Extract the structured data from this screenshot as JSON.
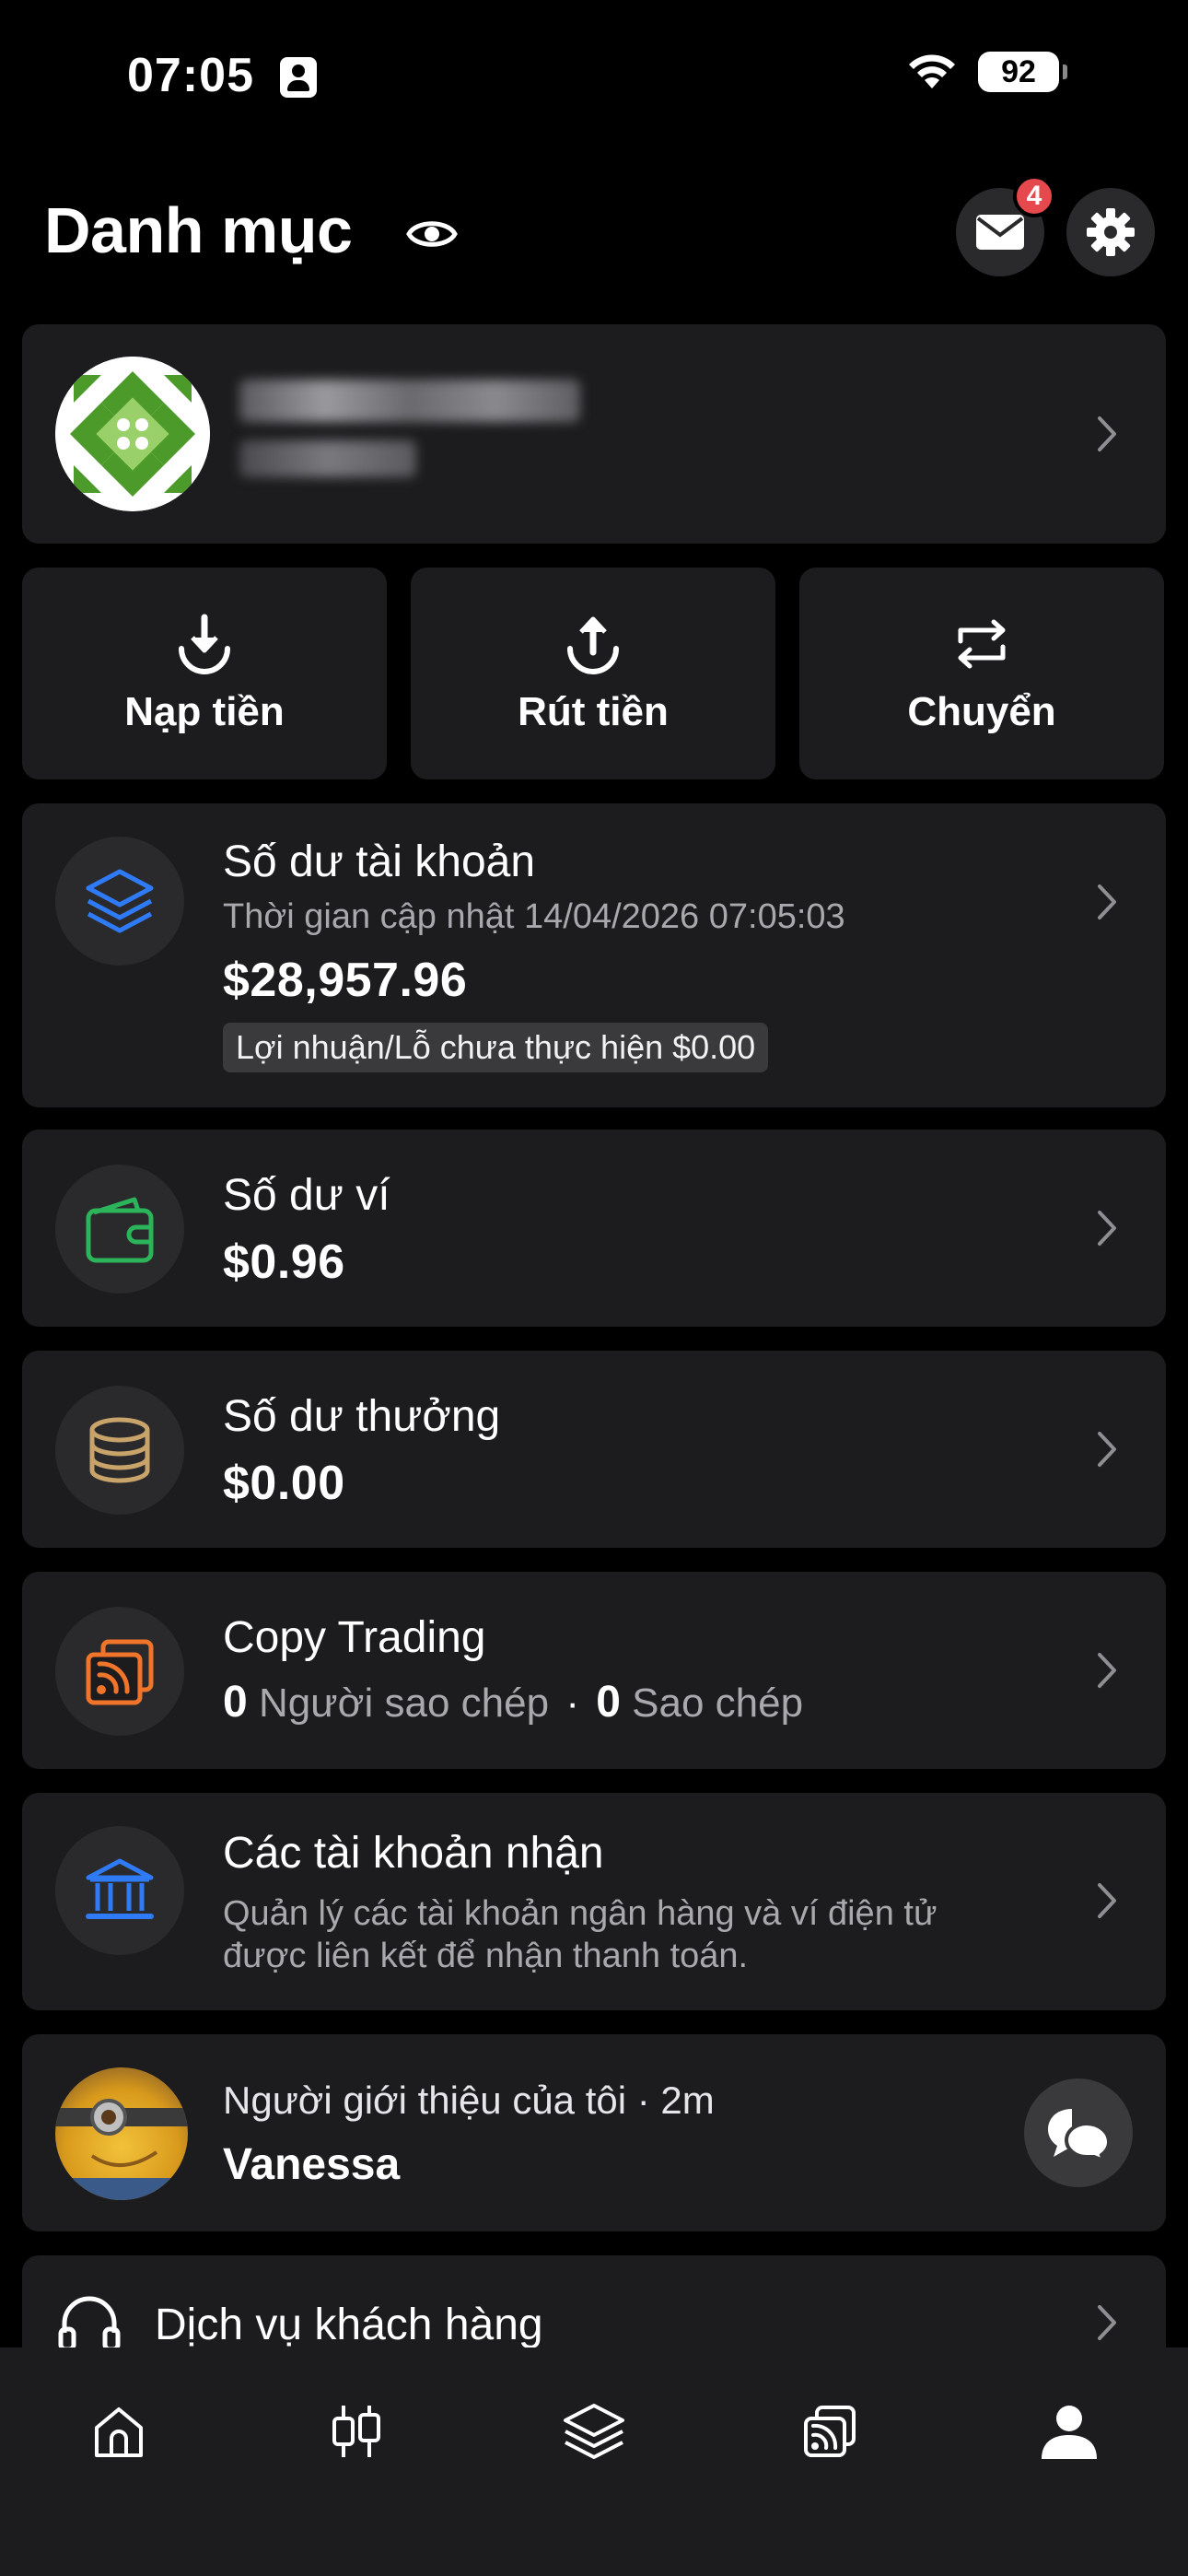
{
  "status": {
    "time": "07:05",
    "battery": "92"
  },
  "header": {
    "title": "Danh mục",
    "mail_badge": "4"
  },
  "actions": [
    {
      "label": "Nạp tiền",
      "icon": "download-icon"
    },
    {
      "label": "Rút tiền",
      "icon": "upload-icon"
    },
    {
      "label": "Chuyển",
      "icon": "transfer-icon"
    }
  ],
  "account_balance": {
    "title": "Số dư tài khoản",
    "updated": "Thời gian cập nhật 14/04/2026 07:05:03",
    "value": "$28,957.96",
    "unrealized": "Lợi nhuận/Lỗ chưa thực hiện $0.00"
  },
  "wallet": {
    "title": "Số dư ví",
    "value": "$0.96"
  },
  "bonus": {
    "title": "Số dư thưởng",
    "value": "$0.00"
  },
  "copy_trading": {
    "title": "Copy Trading",
    "followers_count": "0",
    "followers_label": "Người sao chép",
    "sep": "·",
    "copies_count": "0",
    "copies_label": "Sao chép"
  },
  "receiving_accounts": {
    "title": "Các tài khoản nhận",
    "desc_line1": "Quản lý các tài khoản ngân hàng và ví điện tử",
    "desc_line2": "được liên kết để nhận thanh toán."
  },
  "referrer": {
    "label": "Người giới thiệu của tôi · 2m",
    "name": "Vanessa"
  },
  "support": {
    "title": "Dịch vụ khách hàng"
  },
  "colors": {
    "card": "#1c1c1e",
    "blue": "#2f7bf5",
    "green": "#2bb45a",
    "gold": "#c9a46a",
    "orange": "#f0742a",
    "badge": "#e5484d"
  }
}
